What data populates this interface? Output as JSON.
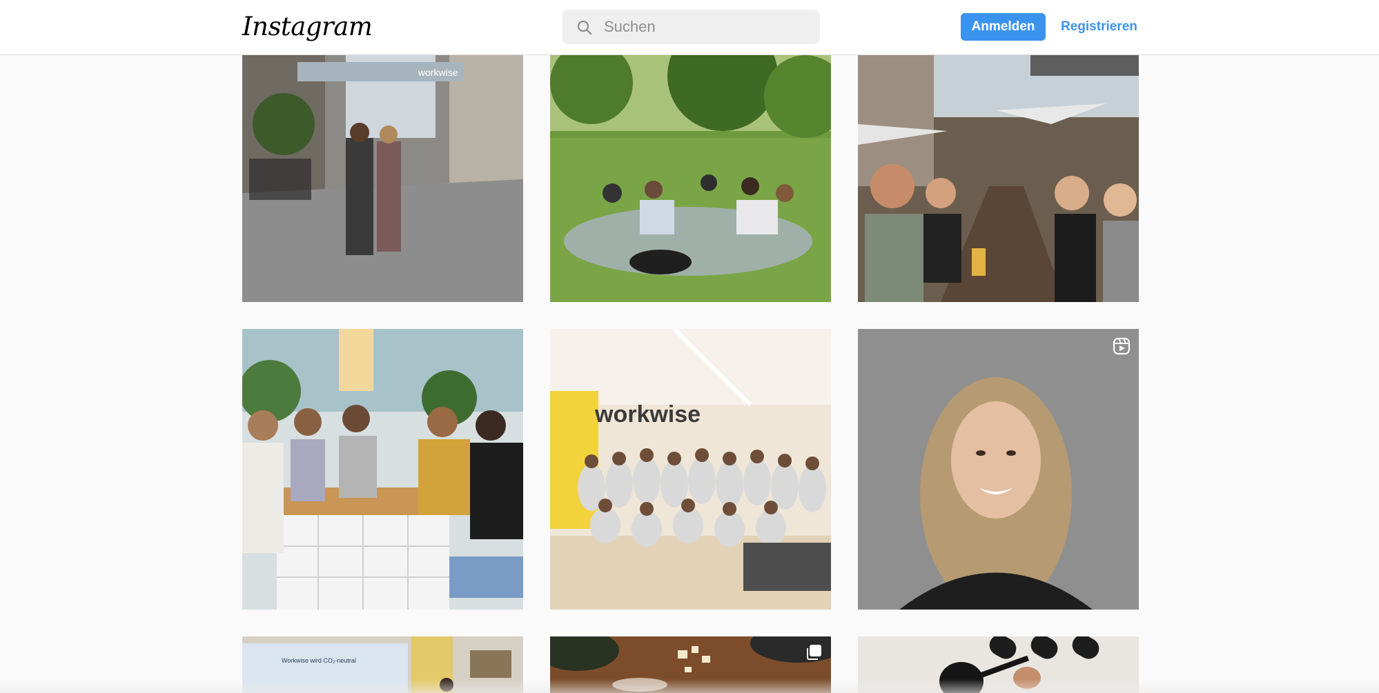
{
  "header": {
    "logo_text": "Instagram",
    "search_placeholder": "Suchen",
    "login_label": "Anmelden",
    "register_label": "Registrieren",
    "accent_color": "#3b93f0"
  },
  "posts": [
    {
      "kind": "photo",
      "badge": null,
      "scene": "two women walking on cobblestone street with workwise banner"
    },
    {
      "kind": "photo",
      "badge": null,
      "scene": "team picnic on grass in park"
    },
    {
      "kind": "photo",
      "badge": null,
      "scene": "team at outdoor beer garden table"
    },
    {
      "kind": "photo",
      "badge": null,
      "scene": "women chatting at wooden kitchen counter"
    },
    {
      "kind": "photo",
      "badge": null,
      "scene": "large team group photo under workwise sign"
    },
    {
      "kind": "reel",
      "badge": "reel-icon",
      "scene": "smiling woman on grey background"
    },
    {
      "kind": "photo",
      "badge": null,
      "scene": "presentation screen"
    },
    {
      "kind": "carousel",
      "badge": "carousel-icon",
      "scene": "food on wooden table"
    },
    {
      "kind": "photo",
      "badge": null,
      "scene": "person with black ladle"
    }
  ],
  "presentation_slide_title": "Workwise wird CO₂-neutral",
  "banner_text": "workwise"
}
